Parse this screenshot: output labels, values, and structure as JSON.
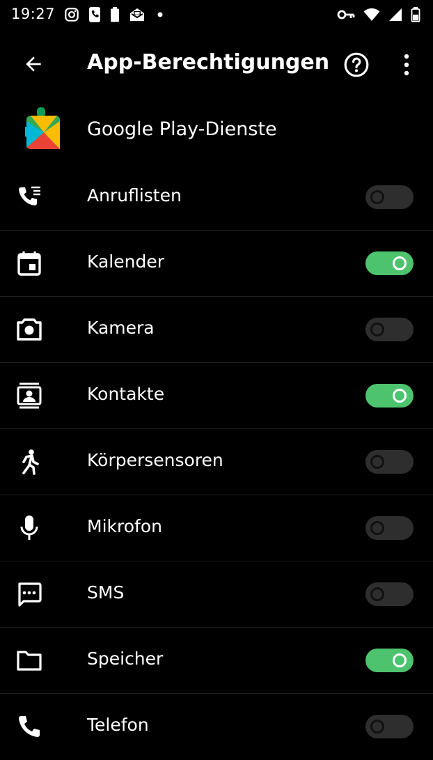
{
  "status_bar": {
    "time": "19:27"
  },
  "app_bar": {
    "title": "App-Berechtigungen"
  },
  "app": {
    "name": "Google Play-Dienste"
  },
  "permissions": [
    {
      "label": "Anruflisten",
      "icon": "call-log-icon",
      "enabled": false
    },
    {
      "label": "Kalender",
      "icon": "calendar-icon",
      "enabled": true
    },
    {
      "label": "Kamera",
      "icon": "camera-icon",
      "enabled": false
    },
    {
      "label": "Kontakte",
      "icon": "contacts-icon",
      "enabled": true
    },
    {
      "label": "Körpersensoren",
      "icon": "body-sensors-icon",
      "enabled": false
    },
    {
      "label": "Mikrofon",
      "icon": "microphone-icon",
      "enabled": false
    },
    {
      "label": "SMS",
      "icon": "sms-icon",
      "enabled": false
    },
    {
      "label": "Speicher",
      "icon": "folder-icon",
      "enabled": true
    },
    {
      "label": "Telefon",
      "icon": "phone-icon",
      "enabled": false
    }
  ],
  "colors": {
    "toggle_on": "#4ec36e",
    "toggle_off": "#2e2e2e",
    "background": "#000000"
  }
}
